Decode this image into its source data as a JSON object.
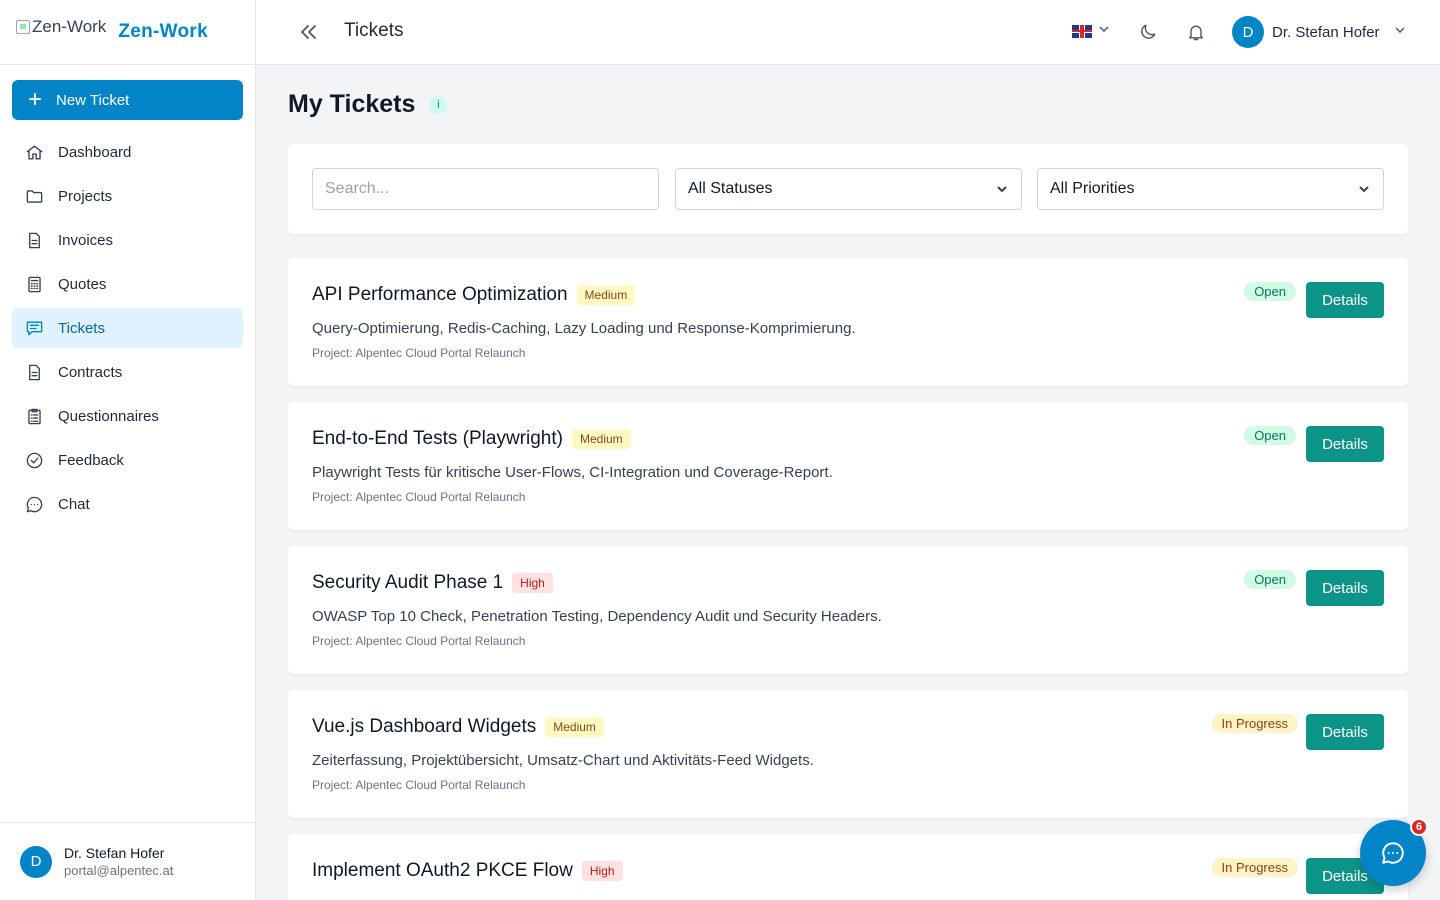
{
  "brand": {
    "logo_alt": "Zen-Work",
    "name": "Zen-Work"
  },
  "sidebar": {
    "new_ticket_label": "New Ticket",
    "items": [
      {
        "label": "Dashboard",
        "icon": "home-icon"
      },
      {
        "label": "Projects",
        "icon": "folder-icon"
      },
      {
        "label": "Invoices",
        "icon": "document-icon"
      },
      {
        "label": "Quotes",
        "icon": "calculator-icon"
      },
      {
        "label": "Tickets",
        "icon": "ticket-chat-icon",
        "active": true
      },
      {
        "label": "Contracts",
        "icon": "document-icon"
      },
      {
        "label": "Questionnaires",
        "icon": "clipboard-list-icon"
      },
      {
        "label": "Feedback",
        "icon": "check-circle-icon"
      },
      {
        "label": "Chat",
        "icon": "chat-bubble-icon"
      }
    ],
    "user": {
      "initial": "D",
      "name": "Dr. Stefan Hofer",
      "email": "portal@alpentec.at"
    }
  },
  "header": {
    "title": "Tickets",
    "user_initial": "D",
    "user_name": "Dr. Stefan Hofer"
  },
  "main": {
    "page_title": "My Tickets",
    "info_label": "i",
    "filters": {
      "search_placeholder": "Search...",
      "status_selected": "All Statuses",
      "priority_selected": "All Priorities"
    },
    "details_label": "Details",
    "tickets": [
      {
        "title": "API Performance Optimization",
        "priority": "Medium",
        "description": "Query-Optimierung, Redis-Caching, Lazy Loading und Response-Komprimierung.",
        "project": "Project: Alpentec Cloud Portal Relaunch",
        "status": "Open"
      },
      {
        "title": "End-to-End Tests (Playwright)",
        "priority": "Medium",
        "description": "Playwright Tests für kritische User-Flows, CI-Integration und Coverage-Report.",
        "project": "Project: Alpentec Cloud Portal Relaunch",
        "status": "Open"
      },
      {
        "title": "Security Audit Phase 1",
        "priority": "High",
        "description": "OWASP Top 10 Check, Penetration Testing, Dependency Audit und Security Headers.",
        "project": "Project: Alpentec Cloud Portal Relaunch",
        "status": "Open"
      },
      {
        "title": "Vue.js Dashboard Widgets",
        "priority": "Medium",
        "description": "Zeiterfassung, Projektübersicht, Umsatz-Chart und Aktivitäts-Feed Widgets.",
        "project": "Project: Alpentec Cloud Portal Relaunch",
        "status": "In Progress"
      },
      {
        "title": "Implement OAuth2 PKCE Flow",
        "priority": "High",
        "description": "",
        "project": "",
        "status": "In Progress"
      }
    ]
  },
  "chat_fab": {
    "badge_count": "6"
  },
  "colors": {
    "primary": "#0284c7",
    "teal_button": "#0d9488",
    "status_open_bg": "#d1fae5",
    "status_progress_bg": "#fef3c7",
    "priority_medium_bg": "#fef9c3",
    "priority_high_bg": "#fee2e2"
  }
}
